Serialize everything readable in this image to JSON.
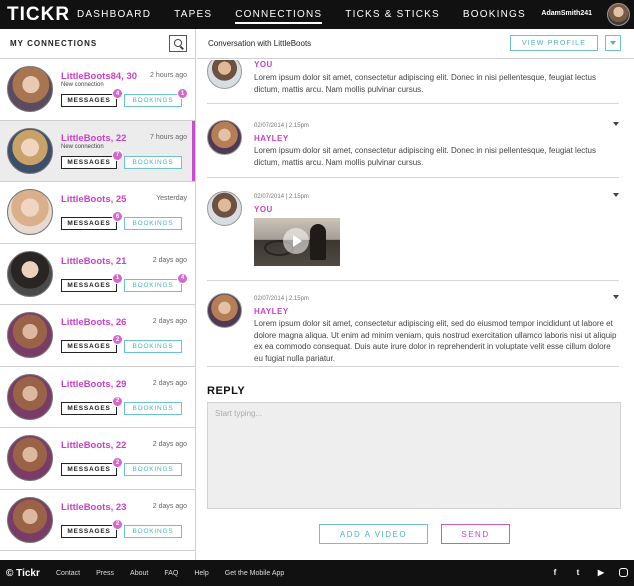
{
  "nav": {
    "logo": "TICKR",
    "links": [
      "DASHBOARD",
      "TAPES",
      "CONNECTIONS",
      "TICKS & STICKS",
      "BOOKINGS"
    ],
    "active_index": 2,
    "username": "AdamSmith241"
  },
  "left_panel": {
    "title": "MY CONNECTIONS",
    "contacts": [
      {
        "name": "LittleBoots84, 30",
        "subtitle": "New connection",
        "time": "2 hours ago",
        "messages_label": "MESSAGES",
        "bookings_label": "BOOKINGS",
        "messages_badge": "4",
        "bookings_badge": "1"
      },
      {
        "name": "LittleBoots, 22",
        "subtitle": "New connection",
        "time": "7 hours ago",
        "messages_label": "MESSAGES",
        "bookings_label": "BOOKINGS",
        "messages_badge": "7",
        "bookings_badge": ""
      },
      {
        "name": "LittleBoots, 25",
        "subtitle": "",
        "time": "Yesterday",
        "messages_label": "MESSAGES",
        "bookings_label": "BOOKINGS",
        "messages_badge": "6",
        "bookings_badge": ""
      },
      {
        "name": "LittleBoots, 21",
        "subtitle": "",
        "time": "2 days ago",
        "messages_label": "MESSAGES",
        "bookings_label": "BOOKINGS",
        "messages_badge": "1",
        "bookings_badge": "4"
      },
      {
        "name": "LittleBoots, 26",
        "subtitle": "",
        "time": "2 days ago",
        "messages_label": "MESSAGES",
        "bookings_label": "BOOKINGS",
        "messages_badge": "2",
        "bookings_badge": ""
      },
      {
        "name": "LittleBoots, 29",
        "subtitle": "",
        "time": "2 days ago",
        "messages_label": "MESSAGES",
        "bookings_label": "BOOKINGS",
        "messages_badge": "2",
        "bookings_badge": ""
      },
      {
        "name": "LittleBoots, 22",
        "subtitle": "",
        "time": "2 days ago",
        "messages_label": "MESSAGES",
        "bookings_label": "BOOKINGS",
        "messages_badge": "2",
        "bookings_badge": ""
      },
      {
        "name": "LittleBoots, 23",
        "subtitle": "",
        "time": "2 days ago",
        "messages_label": "MESSAGES",
        "bookings_label": "BOOKINGS",
        "messages_badge": "2",
        "bookings_badge": ""
      }
    ]
  },
  "conversation": {
    "title": "Conversation with LittleBoots",
    "view_profile_label": "VIEW PROFILE",
    "messages": [
      {
        "meta": "",
        "author": "YOU",
        "text": "Lorem ipsum dolor sit amet, consectetur adipiscing elit. Donec in nisi pellentesque, feugiat lectus dictum, mattis arcu. Nam mollis pulvinar cursus."
      },
      {
        "meta": "02/07/2014  |  2.15pm",
        "author": "HAYLEY",
        "text": "Lorem ipsum dolor sit amet, consectetur adipiscing elit. Donec in nisi pellentesque, feugiat lectus dictum, mattis arcu. Nam mollis pulvinar cursus."
      },
      {
        "meta": "02/07/2014  |  2.15pm",
        "author": "YOU",
        "text": ""
      },
      {
        "meta": "02/07/2014  |  2.15pm",
        "author": "HAYLEY",
        "text": "Lorem ipsum dolor sit amet, consectetur adipiscing elit, sed do eiusmod tempor incididunt ut labore et dolore magna aliqua. Ut enim ad minim veniam, quis nostrud exercitation ullamco laboris nisi ut aliquip ex ea commodo consequat. Duis aute irure dolor in reprehenderit in voluptate velit esse cillum dolore eu fugiat nulla pariatur."
      }
    ]
  },
  "reply": {
    "label": "REPLY",
    "placeholder": "Start typing...",
    "add_video_label": "ADD A VIDEO",
    "send_label": "SEND"
  },
  "footer": {
    "logo": "© Tickr",
    "links": [
      "Contact",
      "Press",
      "About",
      "FAQ",
      "Help",
      "Get the Mobile App"
    ],
    "social_icons": [
      "facebook-icon",
      "twitter-icon",
      "youtube-icon",
      "instagram-icon"
    ],
    "social_glyphs": [
      "f",
      "t",
      "▶",
      ""
    ]
  }
}
